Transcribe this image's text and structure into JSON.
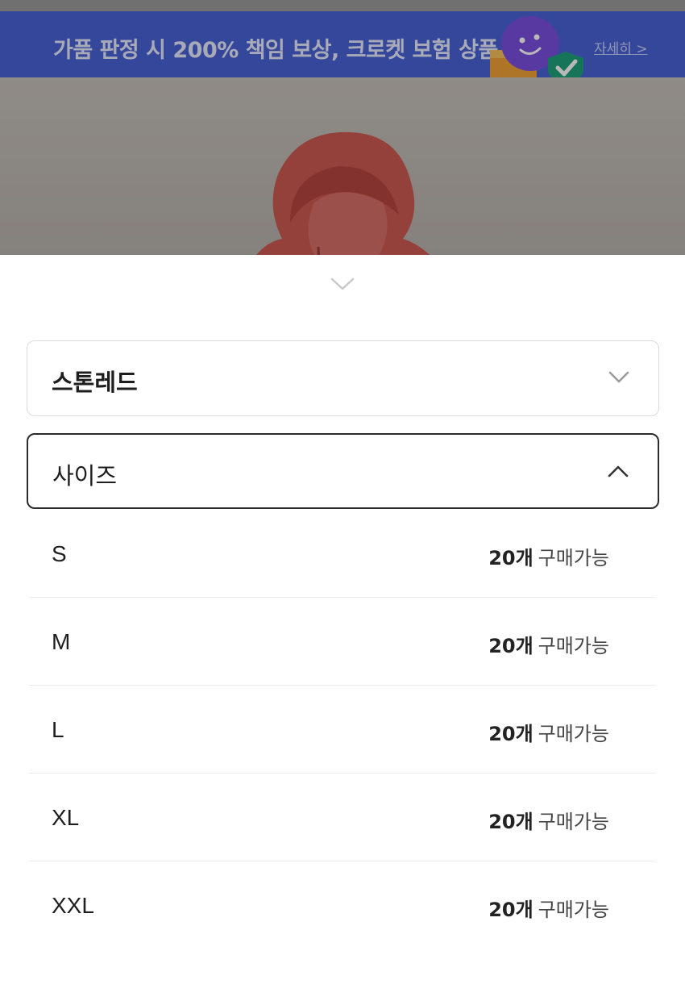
{
  "banner": {
    "text": "가품 판정 시 200% 책임 보상, 크로켓 보험 상품",
    "link": "자세히 >"
  },
  "colors": {
    "banner_bg": "#4a63d6",
    "jacket": "#c9544f",
    "selected_border": "#2b2b2b",
    "default_border": "#dcdcdc"
  },
  "color_select": {
    "label": "스톤레드",
    "icon": "chevron-down-icon"
  },
  "size_select": {
    "label": "사이즈",
    "icon": "chevron-up-icon"
  },
  "sizes": [
    {
      "name": "S",
      "count": "20개",
      "status": "구매가능"
    },
    {
      "name": "M",
      "count": "20개",
      "status": "구매가능"
    },
    {
      "name": "L",
      "count": "20개",
      "status": "구매가능"
    },
    {
      "name": "XL",
      "count": "20개",
      "status": "구매가능"
    },
    {
      "name": "XXL",
      "count": "20개",
      "status": "구매가능"
    }
  ]
}
